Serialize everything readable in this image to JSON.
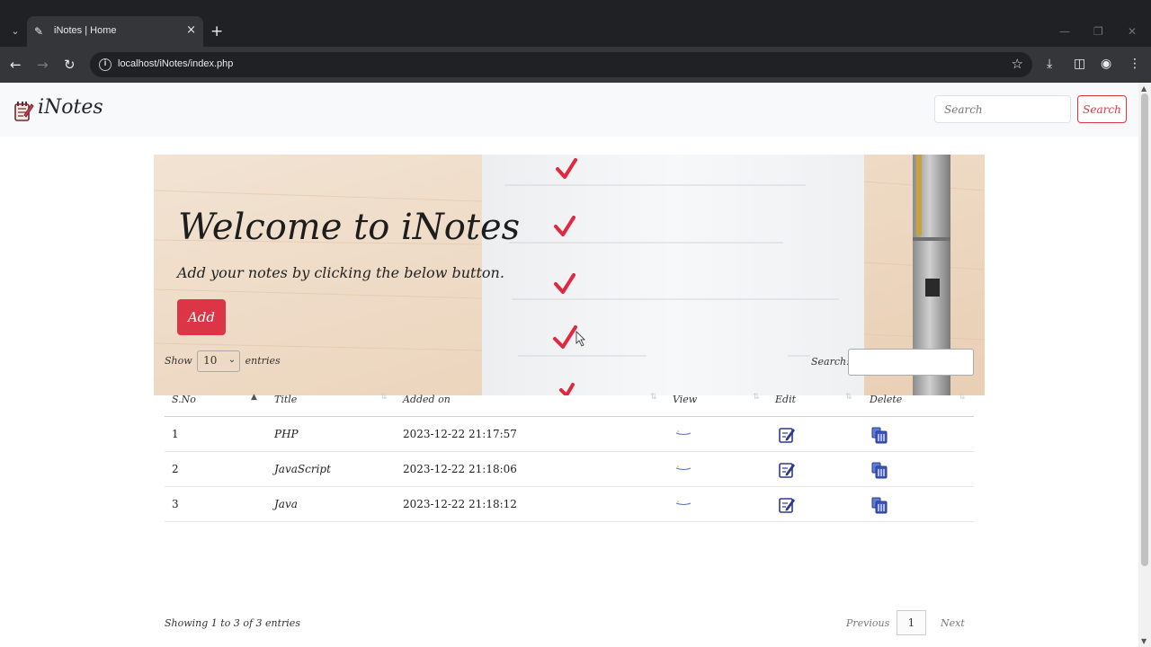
{
  "browser": {
    "tab_title": "iNotes | Home",
    "url": "localhost/iNotes/index.php"
  },
  "navbar": {
    "brand": "iNotes",
    "search_placeholder": "Search",
    "search_button": "Search"
  },
  "hero": {
    "title": "Welcome to iNotes",
    "subtitle": "Add your notes by clicking the below button.",
    "add_button": "Add"
  },
  "table": {
    "length_show": "Show",
    "length_value": "10",
    "length_entries": "entries",
    "search_label": "Search:",
    "columns": [
      "S.No",
      "Title",
      "Added on",
      "View",
      "Edit",
      "Delete"
    ],
    "rows": [
      {
        "sno": "1",
        "title": "PHP",
        "added_on": "2023-12-22 21:17:57"
      },
      {
        "sno": "2",
        "title": "JavaScript",
        "added_on": "2023-12-22 21:18:06"
      },
      {
        "sno": "3",
        "title": "Java",
        "added_on": "2023-12-22 21:18:12"
      }
    ],
    "info": "Showing 1 to 3 of 3 entries",
    "previous": "Previous",
    "page": "1",
    "next": "Next"
  },
  "colors": {
    "accent": "#dc3545",
    "icon_blue": "#3b55b8"
  }
}
